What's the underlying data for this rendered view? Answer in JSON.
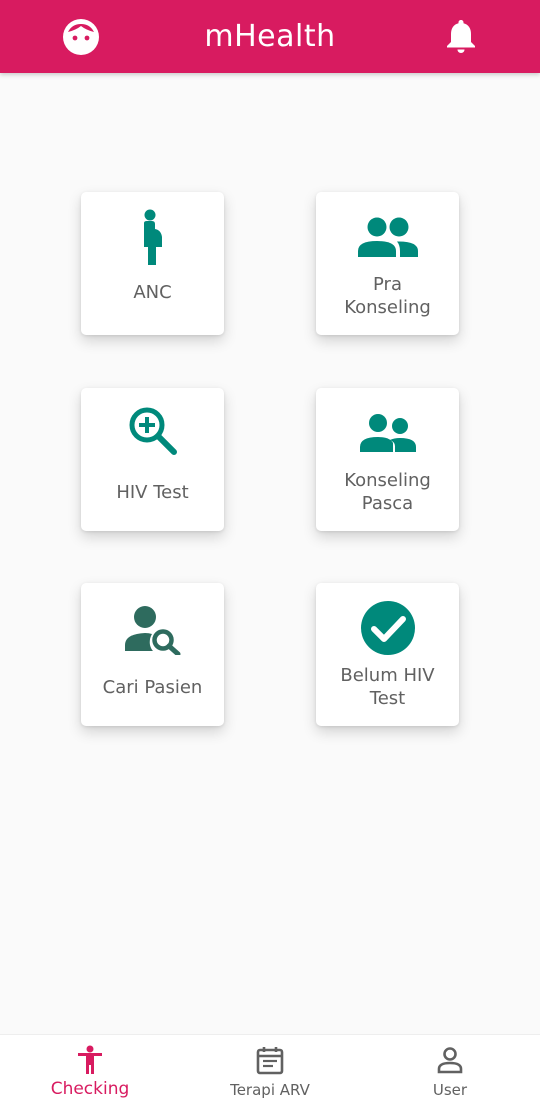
{
  "app": {
    "title": "mHealth",
    "accent_color": "#d81b60",
    "icon_color": "#00897b",
    "left_icon": "face-icon",
    "right_icon": "bell-icon"
  },
  "menu": {
    "items": [
      {
        "label": "ANC",
        "icon": "pregnant-woman-icon"
      },
      {
        "label": "Pra\nKonseling",
        "icon": "group-icon"
      },
      {
        "label": "HIV Test",
        "icon": "zoom-in-icon"
      },
      {
        "label": "Konseling\nPasca",
        "icon": "people-icon"
      },
      {
        "label": "Cari Pasien",
        "icon": "person-search-icon"
      },
      {
        "label": "Belum HIV\nTest",
        "icon": "check-circle-icon"
      }
    ]
  },
  "bottom_nav": {
    "items": [
      {
        "label": "Checking",
        "icon": "accessibility-icon",
        "active": true
      },
      {
        "label": "Terapi ARV",
        "icon": "event-note-icon",
        "active": false
      },
      {
        "label": "User",
        "icon": "person-outline-icon",
        "active": false
      }
    ]
  }
}
